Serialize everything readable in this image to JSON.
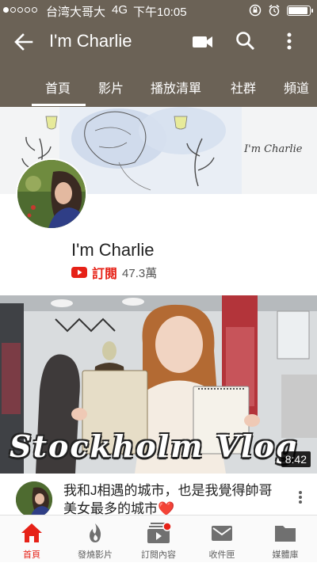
{
  "status_bar": {
    "carrier": "台湾大哥大",
    "network": "4G",
    "time": "下午10:05",
    "signal_strength": 1
  },
  "app_bar": {
    "title": "I'm Charlie",
    "icons": [
      "back-arrow-icon",
      "video-camera-icon",
      "search-icon",
      "more-vert-icon"
    ]
  },
  "tabs": [
    {
      "label": "首頁",
      "active": true
    },
    {
      "label": "影片",
      "active": false
    },
    {
      "label": "播放清單",
      "active": false
    },
    {
      "label": "社群",
      "active": false
    },
    {
      "label": "頻道",
      "active": false
    }
  ],
  "banner": {
    "script_text": "I'm Charlie"
  },
  "channel": {
    "name": "I'm Charlie",
    "subscribe_label": "訂閱",
    "subscriber_count": "47.3萬"
  },
  "featured_video": {
    "thumbnail_text": "Stockholm Vlog",
    "duration": "8:42",
    "title": "我和J相遇的城市，也是我覺得帥哥美女最多的城市❤️"
  },
  "bottom_nav": [
    {
      "label": "首頁",
      "icon": "home-icon",
      "active": true
    },
    {
      "label": "發燒影片",
      "icon": "flame-icon",
      "active": false
    },
    {
      "label": "訂閱內容",
      "icon": "subscriptions-icon",
      "active": false
    },
    {
      "label": "收件匣",
      "icon": "mail-icon",
      "active": false
    },
    {
      "label": "媒體庫",
      "icon": "folder-icon",
      "active": false
    }
  ],
  "colors": {
    "header": "#6b6256",
    "accent_red": "#e62117"
  }
}
